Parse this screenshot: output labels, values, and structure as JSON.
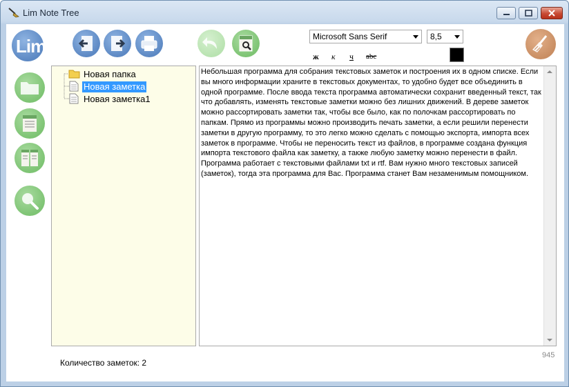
{
  "window": {
    "title": "Lim Note Tree"
  },
  "toolbar": {
    "logo_text": "Lim",
    "font_name": "Microsoft Sans Serif",
    "font_size": "8,5",
    "bold_label": "ж",
    "italic_label": "к",
    "underline_label": "ч",
    "strike_label": "abc",
    "text_color": "#000000"
  },
  "tree": {
    "items": [
      {
        "label": "Новая папка",
        "type": "folder"
      },
      {
        "label": "Новая заметка",
        "type": "note"
      },
      {
        "label": "Новая заметка1",
        "type": "note"
      }
    ]
  },
  "editor": {
    "text": "Небольшая программа для собрания текстовых заметок и построения их в одном списке. Если вы много информации храните в текстовых документах, то удобно будет все объединить в одной программе. После ввода текста программа автоматически сохранит введенный текст, так что добавлять, изменять текстовые заметки можно без лишних движений. В дереве заметок можно рассортировать заметки так, чтобы все было, как по полочкам рассортировать по папкам. Прямо из программы можно производить печать заметки, а если решили перенести заметки в другую программу, то это легко можно сделать с помощью экспорта, импорта всех заметок в программе. Чтобы не переносить текст из файлов, в программе создана функция импорта текстового файла как заметку, а также любую заметку можно перенести в файл. Программа работает с текстовыми файлами txt и rtf. Вам нужно много текстовых записей (заметок), тогда эта программа для Вас. Программа станет Вам незаменимым помощником."
  },
  "status": {
    "count_label": "Количество заметок: 2",
    "char_count": "945"
  },
  "colors": {
    "accent_blue": "#5d89c4",
    "accent_green": "#7ec474",
    "selection": "#3399ff",
    "tree_bg": "#fdfde8"
  }
}
